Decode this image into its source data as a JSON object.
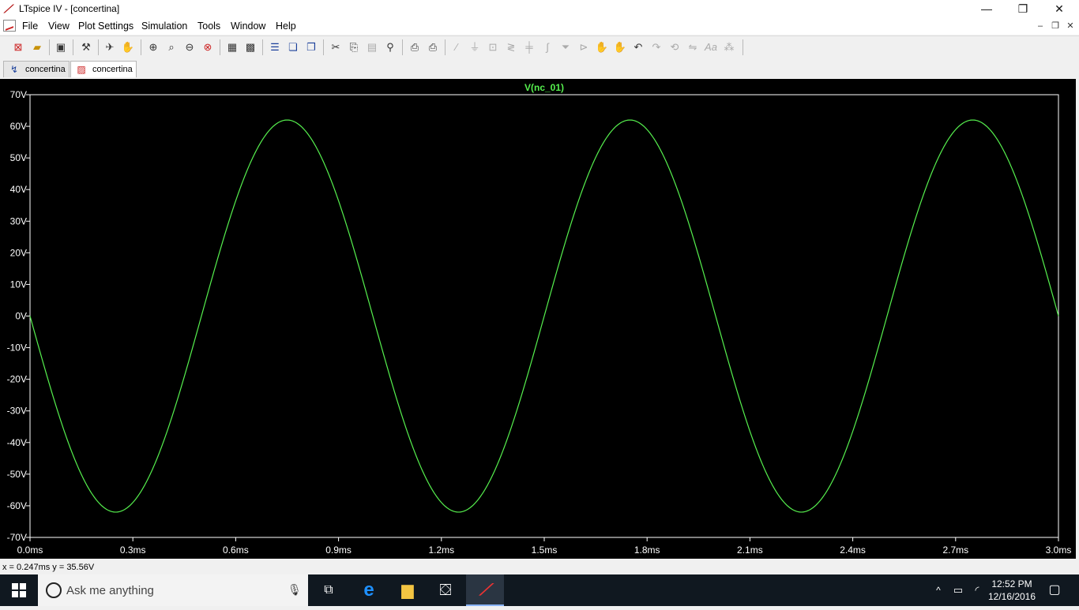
{
  "window": {
    "title": "LTspice IV - [concertina]",
    "minimize_glyph": "—",
    "restore_glyph": "❐",
    "close_glyph": "✕"
  },
  "menu": {
    "items": [
      "File",
      "View",
      "Plot Settings",
      "Simulation",
      "Tools",
      "Window",
      "Help"
    ],
    "mdi_minimize": "–",
    "mdi_restore": "❐",
    "mdi_close": "✕"
  },
  "toolbar": {
    "icons": [
      "new-schematic-icon",
      "open-icon",
      "save-icon",
      "hammer-icon",
      "run-icon",
      "halt-icon",
      "zoom-in-icon",
      "zoom-area-icon",
      "zoom-out-icon",
      "zoom-cancel-icon",
      "autorange-icon",
      "zoom-fit-icon",
      "tile-horizontal-icon",
      "cascade-icon",
      "tile-vertical-icon",
      "cut-icon",
      "copy-icon",
      "paste-icon",
      "find-icon",
      "print-preview-icon",
      "print-icon",
      "wire-icon",
      "ground-icon",
      "label-icon",
      "resistor-icon",
      "capacitor-icon",
      "inductor-icon",
      "diode-icon",
      "component-icon",
      "move-icon",
      "drag-icon",
      "undo-icon",
      "redo-icon",
      "rotate-icon",
      "mirror-icon",
      "text-icon",
      "spice-directive-icon"
    ]
  },
  "tabs": [
    {
      "label": "concertina",
      "icon": "schematic-icon"
    },
    {
      "label": "concertina",
      "icon": "waveform-icon"
    }
  ],
  "chart_data": {
    "type": "line",
    "title": "V(nc_01)",
    "xlabel": "",
    "ylabel": "",
    "xlim": [
      0.0,
      3.0
    ],
    "ylim": [
      -70,
      70
    ],
    "x_ticks": [
      0.0,
      0.3,
      0.6,
      0.9,
      1.2,
      1.5,
      1.8,
      2.1,
      2.4,
      2.7,
      3.0
    ],
    "x_tick_labels": [
      "0.0ms",
      "0.3ms",
      "0.6ms",
      "0.9ms",
      "1.2ms",
      "1.5ms",
      "1.8ms",
      "2.1ms",
      "2.4ms",
      "2.7ms",
      "3.0ms"
    ],
    "y_ticks": [
      70,
      60,
      50,
      40,
      30,
      20,
      10,
      0,
      -10,
      -20,
      -30,
      -40,
      -50,
      -60,
      -70
    ],
    "y_tick_labels": [
      "70V",
      "60V",
      "50V",
      "40V",
      "30V",
      "20V",
      "10V",
      "0V",
      "-10V",
      "-20V",
      "-30V",
      "-40V",
      "-50V",
      "-60V",
      "-70V"
    ],
    "grid": false,
    "series": [
      {
        "name": "V(nc_01)",
        "color": "#56f04e",
        "x": [
          0.0,
          0.25,
          0.5,
          0.75,
          1.0,
          1.25,
          1.5,
          1.75,
          2.0,
          2.25,
          2.5,
          2.75,
          3.0
        ],
        "y": [
          0,
          -62,
          0,
          62,
          0,
          -62,
          0,
          62,
          0,
          -62,
          0,
          62,
          0
        ],
        "waveform": "sine",
        "amplitude": 62,
        "period": 1.0,
        "phase_sign": -1
      }
    ]
  },
  "status": {
    "readout": "x = 0.247ms   y = 35.56V"
  },
  "taskbar": {
    "search_placeholder": "Ask me anything",
    "time": "12:52 PM",
    "date": "12/16/2016",
    "tray_up_glyph": "^"
  }
}
